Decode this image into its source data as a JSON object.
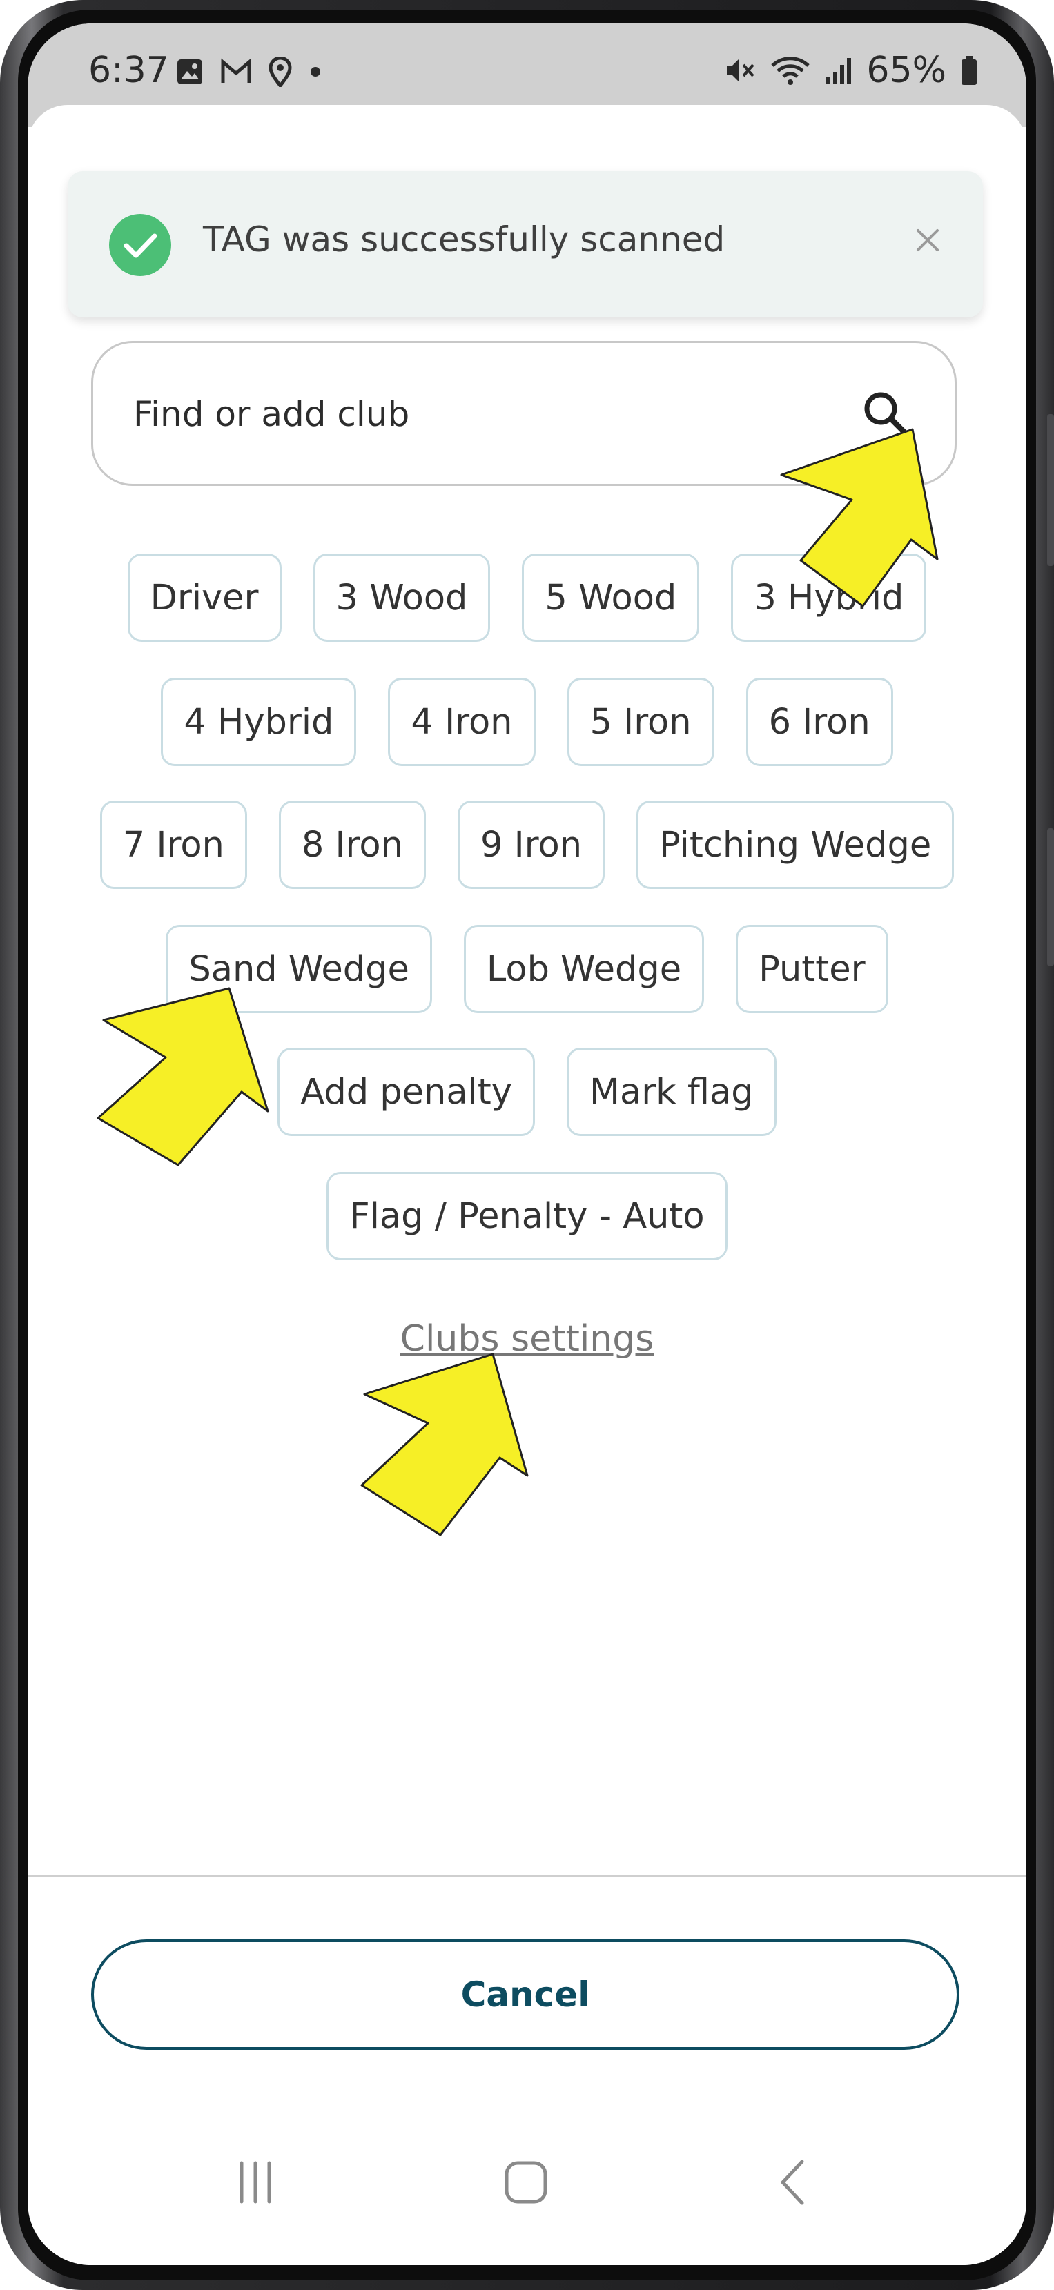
{
  "status_bar": {
    "time": "6:37",
    "battery_percent": "65%",
    "left_icons": [
      "image-icon",
      "gmail-icon",
      "location-icon",
      "dot-icon"
    ],
    "right_icons": [
      "mute-icon",
      "wifi-icon",
      "signal-icon",
      "battery-icon"
    ]
  },
  "toast": {
    "message": "TAG was successfully scanned",
    "icon": "check-circle-icon",
    "close_icon": "close-icon",
    "color": "#4cbf76"
  },
  "search": {
    "placeholder": "Find or add club",
    "icon": "search-icon"
  },
  "clubs": {
    "rows": [
      [
        "Driver",
        "3 Wood",
        "5 Wood",
        "3 Hybrid"
      ],
      [
        "4 Hybrid",
        "4 Iron",
        "5 Iron",
        "6 Iron"
      ],
      [
        "7 Iron",
        "8 Iron",
        "9 Iron",
        "Pitching Wedge"
      ],
      [
        "Sand Wedge",
        "Lob Wedge",
        "Putter"
      ],
      [
        "Add penalty",
        "Mark flag"
      ],
      [
        "Flag / Penalty - Auto"
      ]
    ]
  },
  "clubs_settings_label": "Clubs settings",
  "cancel_label": "Cancel",
  "nav": [
    "recent-apps-icon",
    "home-icon",
    "back-icon"
  ],
  "colors": {
    "accent": "#0d4c60",
    "chip_border": "#c9dde3",
    "annotation_arrow": "#f6ef26"
  }
}
